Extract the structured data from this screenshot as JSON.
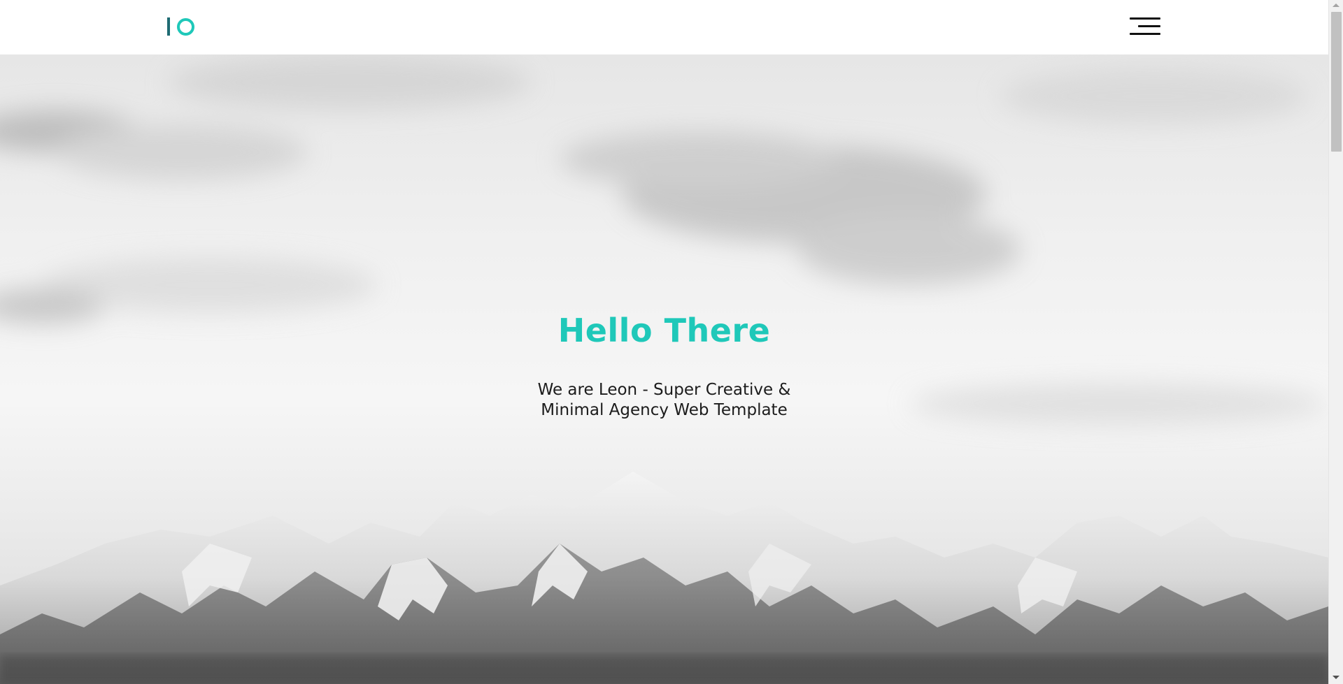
{
  "header": {
    "logo_icon": "leon-logo-mark",
    "menu_icon": "hamburger-menu-icon"
  },
  "hero": {
    "title": "Hello There",
    "subtitle_line1": "We are Leon - Super Creative &",
    "subtitle_line2": "Minimal Agency Web Template",
    "background": "grayscale-snowy-mountains-image"
  },
  "colors": {
    "accent": "#1fc8b9",
    "logo_dark": "#1f6b73",
    "text": "#1c1c1c",
    "header_bg": "#ffffff"
  }
}
